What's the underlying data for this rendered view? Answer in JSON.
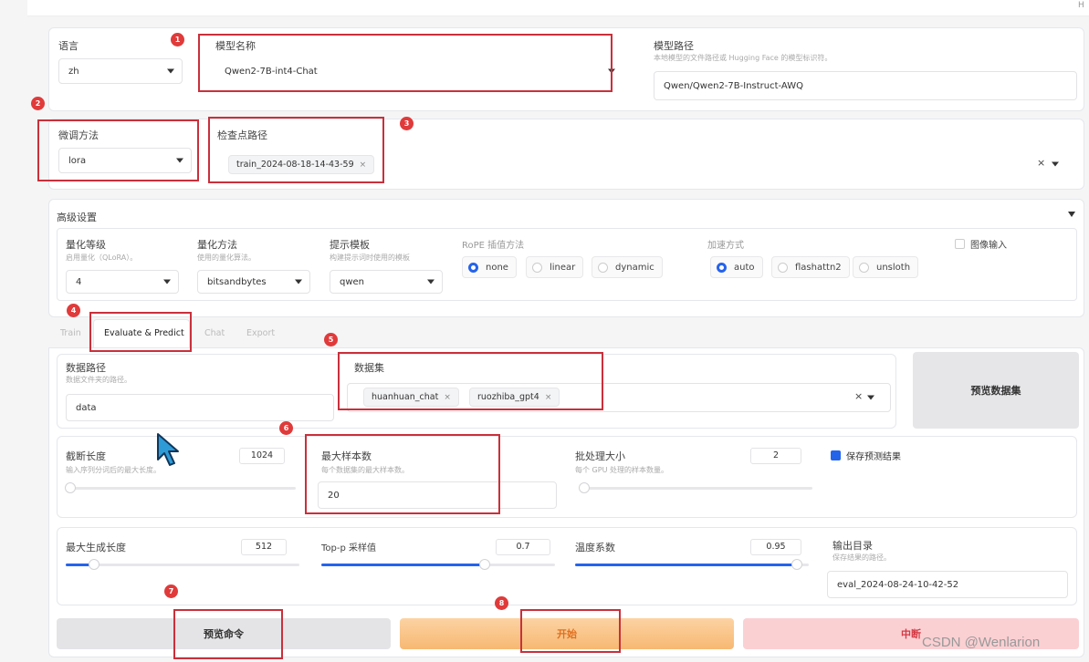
{
  "top_corner_letter": "H",
  "model": {
    "lang_label": "语言",
    "lang_value": "zh",
    "model_name_label": "模型名称",
    "model_name_value": "Qwen2-7B-int4-Chat",
    "model_path_label": "模型路径",
    "model_path_hint": "本地模型的文件路径或 Hugging Face 的模型标识符。",
    "model_path_value": "Qwen/Qwen2-7B-Instruct-AWQ"
  },
  "finetune": {
    "method_label": "微调方法",
    "method_value": "lora",
    "checkpoint_label": "检查点路径",
    "checkpoint_tag": "train_2024-08-18-14-43-59",
    "clear_icon": "×"
  },
  "advanced": {
    "title": "高级设置",
    "quant_bit_label": "量化等级",
    "quant_bit_hint": "启用量化（QLoRA）。",
    "quant_bit_value": "4",
    "quant_method_label": "量化方法",
    "quant_method_hint": "使用的量化算法。",
    "quant_method_value": "bitsandbytes",
    "template_label": "提示模板",
    "template_hint": "构建提示词时使用的模板",
    "template_value": "qwen",
    "rope_label": "RoPE 插值方法",
    "rope_options": [
      "none",
      "linear",
      "dynamic"
    ],
    "booster_label": "加速方式",
    "booster_options": [
      "auto",
      "flashattn2",
      "unsloth"
    ],
    "image_input_label": "图像输入"
  },
  "tabs": [
    "Train",
    "Evaluate & Predict",
    "Chat",
    "Export"
  ],
  "evaluate": {
    "data_dir_label": "数据路径",
    "data_dir_hint": "数据文件夹的路径。",
    "data_dir_value": "data",
    "dataset_label": "数据集",
    "dataset_tags": [
      "huanhuan_chat",
      "ruozhiba_gpt4"
    ],
    "preview_dataset_btn": "预览数据集",
    "cutoff_label": "截断长度",
    "cutoff_hint": "输入序列分词后的最大长度。",
    "cutoff_value": "1024",
    "max_samples_label": "最大样本数",
    "max_samples_hint": "每个数据集的最大样本数。",
    "max_samples_value": "20",
    "batch_label": "批处理大小",
    "batch_hint": "每个 GPU 处理的样本数量。",
    "batch_value": "2",
    "predict_label": "保存预测结果",
    "max_new_tokens_label": "最大生成长度",
    "max_new_tokens_value": "512",
    "top_p_label": "Top-p 采样值",
    "top_p_value": "0.7",
    "temperature_label": "温度系数",
    "temperature_value": "0.95",
    "output_dir_label": "输出目录",
    "output_dir_hint": "保存结果的路径。",
    "output_dir_value": "eval_2024-08-24-10-42-52"
  },
  "slider_levels": {
    "cutoff": 0.01,
    "max_new_tokens": 0.12,
    "top_p": 0.7,
    "temperature": 0.95
  },
  "actions": {
    "preview_cmd": "预览命令",
    "start": "开始",
    "abort": "中断"
  },
  "badges": [
    "1",
    "2",
    "3",
    "4",
    "5",
    "6",
    "7",
    "8"
  ],
  "watermark": "CSDN @Wenlarion",
  "colors": {
    "accent": "#2563eb",
    "annotation": "#c9303b",
    "start_button": "#f9c48a",
    "abort_button": "#fbd0d3"
  }
}
